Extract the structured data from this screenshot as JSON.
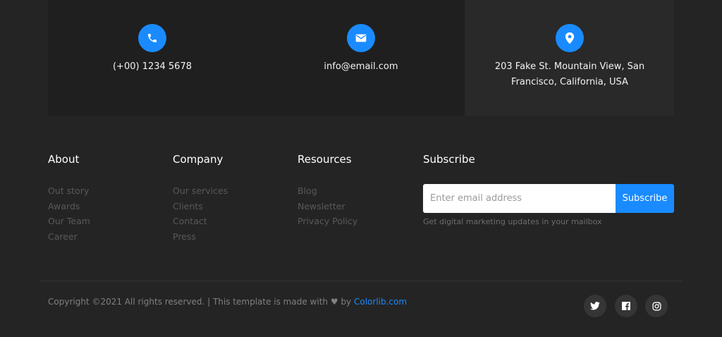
{
  "contact": {
    "phone": "(+00) 1234 5678",
    "email": "info@email.com",
    "address": "203 Fake St. Mountain View, San Francisco, California, USA"
  },
  "footer": {
    "about": {
      "title": "About",
      "links": [
        "Out story",
        "Awards",
        "Our Team",
        "Career"
      ]
    },
    "company": {
      "title": "Company",
      "links": [
        "Our services",
        "Clients",
        "Contact",
        "Press"
      ]
    },
    "resources": {
      "title": "Resources",
      "links": [
        "Blog",
        "Newsletter",
        "Privacy Policy"
      ]
    },
    "subscribe": {
      "title": "Subscribe",
      "placeholder": "Enter email address",
      "button": "Subscribe",
      "hint": "Get digital marketing updates in your mailbox"
    }
  },
  "bottom": {
    "copyright_prefix": "Copyright ©2021 All rights reserved. | This template is made with",
    "by": "by",
    "link": "Colorlib.com"
  },
  "icons": {
    "phone": "phone-icon",
    "email": "envelope-icon",
    "address": "map-pin-icon",
    "heart": "heart-icon",
    "social": [
      "twitter-icon",
      "facebook-icon",
      "instagram-icon"
    ]
  },
  "colors": {
    "background": "#242424",
    "panel": "#1f1f1f",
    "accent": "#1a8bff"
  }
}
